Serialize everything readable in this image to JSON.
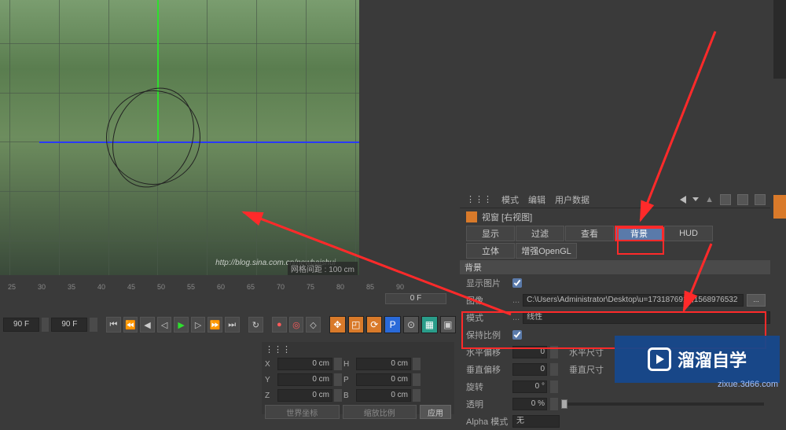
{
  "viewport": {
    "watermark": "http://blog.sina.com.cn/newbaishui",
    "grid_label": "网格间距 : 100 cm"
  },
  "ruler": {
    "ticks": [
      "25",
      "30",
      "35",
      "40",
      "45",
      "50",
      "55",
      "60",
      "65",
      "70",
      "75",
      "80",
      "85",
      "90"
    ]
  },
  "frame_readout": "0 F",
  "timeline": {
    "frame_start": "90 F",
    "frame_cur": "90 F"
  },
  "coords": {
    "rows": [
      {
        "axis": "X",
        "pos": "0 cm",
        "dim": "0 cm"
      },
      {
        "axis": "Y",
        "pos": "0 cm",
        "dim": "0 cm"
      },
      {
        "axis": "Z",
        "pos": "0 cm",
        "dim": "0 cm"
      }
    ],
    "label_h": "H",
    "label_p": "P",
    "label_b": "B",
    "dropdown1": "世界坐标",
    "dropdown2": "缩放比例",
    "apply": "应用"
  },
  "right": {
    "menu": {
      "mode": "模式",
      "edit": "编辑",
      "userdata": "用户数据"
    },
    "window_title": "视窗 [右视图]",
    "tabs": {
      "display": "显示",
      "filter": "过滤",
      "view": "查看",
      "background": "背景",
      "hud": "HUD",
      "stereo": "立体",
      "opengl": "增强OpenGL"
    },
    "section": "背景",
    "props": {
      "show_image": "显示图片",
      "image": "图像",
      "image_path": "C:\\Users\\Administrator\\Desktop\\u=1731876914,1568976532",
      "browse": "...",
      "mode": "模式",
      "mode_value": "线性",
      "keep_ratio": "保持比例",
      "h_offset": "水平偏移",
      "h_offset_val": "0",
      "h_size": "水平尺寸",
      "v_offset": "垂直偏移",
      "v_offset_val": "0",
      "v_size": "垂直尺寸",
      "rotate": "旋转",
      "rotate_val": "0 °",
      "opacity": "透明",
      "opacity_val": "0 %",
      "alpha": "Alpha 模式",
      "alpha_val": "无"
    }
  },
  "logo": {
    "text": "溜溜自学",
    "url": "zixue.3d66.com"
  }
}
